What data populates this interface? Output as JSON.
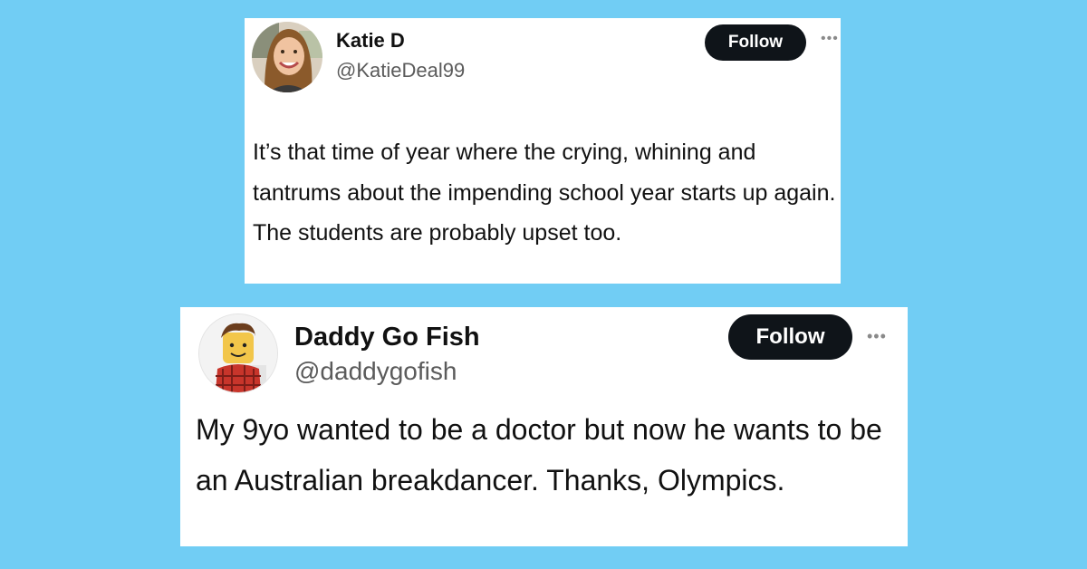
{
  "colors": {
    "background": "#71cdf4",
    "follow_button": "#0f1419"
  },
  "tweets": [
    {
      "name": "Katie D",
      "handle": "@KatieDeal99",
      "follow_label": "Follow",
      "more_icon": "more-horizontal-icon",
      "text": "It’s that time of year where the crying, whining and tantrums about the impending school year starts up again. The students are probably upset too."
    },
    {
      "name": "Daddy Go Fish",
      "handle": "@daddygofish",
      "follow_label": "Follow",
      "more_icon": "more-horizontal-icon",
      "text": "My 9yo wanted to be a doctor but now he wants to be an Australian breakdancer. Thanks, Olympics."
    }
  ]
}
